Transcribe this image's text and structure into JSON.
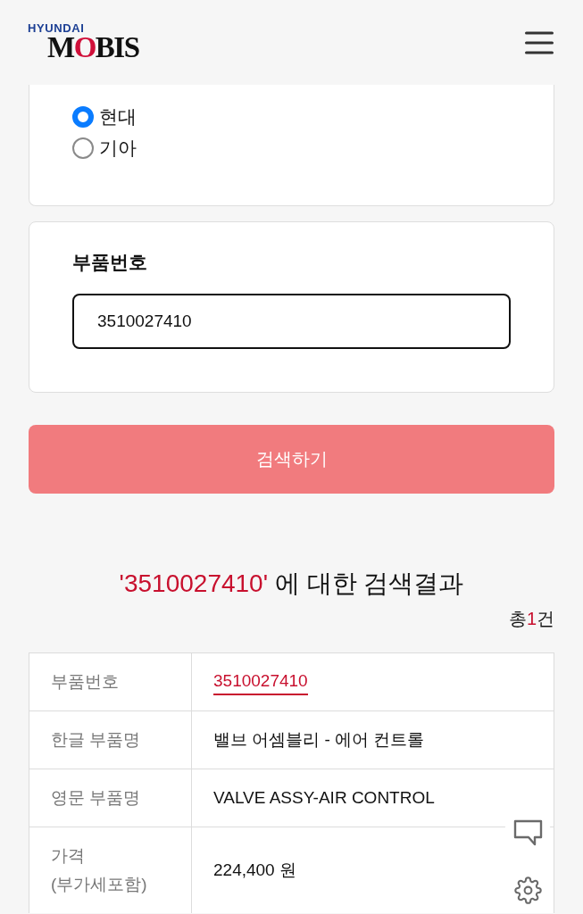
{
  "header": {
    "logo": {
      "brand": "HYUNDAI",
      "name": "MOBIS"
    }
  },
  "maker_options": [
    {
      "label": "현대",
      "selected": true
    },
    {
      "label": "기아",
      "selected": false
    }
  ],
  "part_number_field": {
    "label": "부품번호",
    "value": "3510027410"
  },
  "search_button": "검색하기",
  "results": {
    "heading": {
      "query": "'3510027410'",
      "text": "에 대한 검색결과"
    },
    "total": {
      "prefix": "총",
      "count": "1",
      "suffix": "건"
    }
  },
  "detail_rows": [
    {
      "label": "부품번호",
      "value": "3510027410",
      "kind": "link"
    },
    {
      "label": "한글 부품명",
      "value": "밸브 어셈블리 - 에어 컨트롤",
      "kind": "text"
    },
    {
      "label": "영문 부품명",
      "value": "VALVE ASSY-AIR CONTROL",
      "kind": "text"
    },
    {
      "label": "가격\n(부가세포함)",
      "value": "224,400 원",
      "kind": "text"
    }
  ]
}
